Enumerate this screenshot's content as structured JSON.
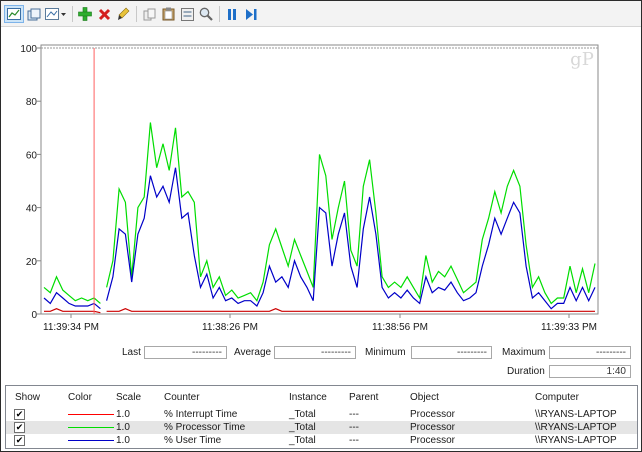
{
  "toolbar": {
    "buttons": [
      {
        "icon": "view-graph-icon",
        "selected": true
      },
      {
        "icon": "copy-properties-icon"
      },
      {
        "icon": "change-graph-type-icon"
      },
      {
        "icon": "add-counter-icon"
      },
      {
        "icon": "delete-counter-icon"
      },
      {
        "icon": "highlight-icon"
      },
      {
        "icon": "copy-icon"
      },
      {
        "icon": "paste-icon"
      },
      {
        "icon": "properties-icon"
      },
      {
        "icon": "zoom-icon"
      },
      {
        "icon": "freeze-display-icon"
      },
      {
        "icon": "update-data-icon"
      }
    ]
  },
  "watermark": "gP",
  "chart_data": {
    "type": "line",
    "ylim": [
      0,
      100
    ],
    "yticks": [
      "0",
      "20",
      "40",
      "60",
      "80",
      "100"
    ],
    "xtick_labels": [
      "11:39:34 PM",
      "11:38:26 PM",
      "11:38:56 PM",
      "11:39:33 PM"
    ],
    "cursor_sample": 8,
    "gap_after_sample": 9,
    "series": [
      {
        "name": "% Processor Time",
        "color": "#00dd00",
        "values": [
          10,
          8,
          14,
          9,
          7,
          5,
          6,
          5,
          6,
          4,
          10,
          20,
          47,
          42,
          14,
          40,
          44,
          72,
          55,
          64,
          54,
          70,
          44,
          46,
          42,
          14,
          20,
          10,
          14,
          7,
          9,
          6,
          7,
          8,
          5,
          12,
          26,
          32,
          25,
          18,
          28,
          22,
          16,
          10,
          60,
          52,
          28,
          40,
          50,
          24,
          18,
          48,
          58,
          38,
          14,
          10,
          12,
          10,
          14,
          10,
          6,
          22,
          12,
          16,
          14,
          18,
          13,
          8,
          10,
          12,
          28,
          36,
          46,
          38,
          48,
          54,
          48,
          26,
          10,
          14,
          8,
          4,
          6,
          6,
          18,
          8,
          17,
          8,
          19
        ]
      },
      {
        "name": "% User Time",
        "color": "#0000c8",
        "values": [
          6,
          4,
          8,
          6,
          4,
          3,
          3,
          3,
          4,
          2,
          5,
          14,
          32,
          30,
          12,
          30,
          36,
          52,
          44,
          48,
          42,
          55,
          36,
          38,
          22,
          10,
          15,
          6,
          10,
          5,
          6,
          4,
          5,
          5,
          3,
          8,
          18,
          12,
          14,
          10,
          20,
          14,
          10,
          5,
          40,
          38,
          18,
          30,
          38,
          18,
          10,
          32,
          44,
          30,
          10,
          6,
          8,
          6,
          9,
          6,
          4,
          14,
          8,
          10,
          9,
          12,
          8,
          5,
          6,
          8,
          18,
          26,
          36,
          30,
          36,
          42,
          38,
          18,
          6,
          8,
          5,
          2,
          4,
          4,
          10,
          5,
          10,
          5,
          10
        ]
      },
      {
        "name": "% Interrupt Time",
        "color": "#cc0000",
        "values": [
          1,
          1,
          2,
          1,
          1,
          1,
          1,
          1,
          1,
          0.5,
          1,
          1,
          1,
          2,
          1,
          1,
          1,
          1,
          1,
          1,
          1,
          1,
          1,
          1,
          1,
          1,
          1,
          1,
          1,
          1,
          1,
          1,
          1,
          1,
          1,
          1,
          1,
          2,
          1,
          1,
          1,
          1,
          1,
          1,
          1,
          1,
          1,
          1,
          1,
          1,
          1,
          1,
          1,
          1,
          1,
          1,
          1,
          1,
          1,
          1,
          1,
          1,
          1,
          1,
          1,
          1,
          1,
          1,
          1,
          1,
          1,
          1,
          1,
          1,
          1,
          1,
          1,
          1,
          1,
          1,
          1,
          1,
          1,
          1,
          1,
          1,
          1,
          1,
          1
        ]
      }
    ]
  },
  "stats": {
    "last_label": "Last",
    "last_value": "---------",
    "average_label": "Average",
    "average_value": "---------",
    "minimum_label": "Minimum",
    "minimum_value": "---------",
    "maximum_label": "Maximum",
    "maximum_value": "---------",
    "duration_label": "Duration",
    "duration_value": "1:40"
  },
  "legend": {
    "headers": {
      "show": "Show",
      "color": "Color",
      "scale": "Scale",
      "counter": "Counter",
      "instance": "Instance",
      "parent": "Parent",
      "object": "Object",
      "computer": "Computer"
    },
    "rows": [
      {
        "checked": "✔",
        "color": "#ff0000",
        "scale": "1.0",
        "counter": "% Interrupt Time",
        "instance": "_Total",
        "parent": "---",
        "object": "Processor",
        "computer": "\\\\RYANS-LAPTOP"
      },
      {
        "checked": "✔",
        "color": "#00dd00",
        "scale": "1.0",
        "counter": "% Processor Time",
        "instance": "_Total",
        "parent": "---",
        "object": "Processor",
        "computer": "\\\\RYANS-LAPTOP"
      },
      {
        "checked": "✔",
        "color": "#0000c8",
        "scale": "1.0",
        "counter": "% User Time",
        "instance": "_Total",
        "parent": "---",
        "object": "Processor",
        "computer": "\\\\RYANS-LAPTOP"
      }
    ]
  }
}
